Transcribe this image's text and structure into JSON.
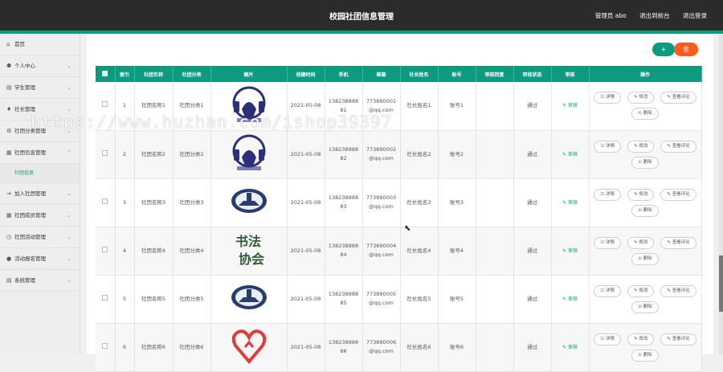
{
  "header": {
    "title": "校园社团信息管理",
    "user_label": "管理员 abo",
    "back_label": "退出到前台",
    "logout_label": "退出登录"
  },
  "sidebar": {
    "items": [
      {
        "label": "首页",
        "icon": "home-icon",
        "glyph": "⌂"
      },
      {
        "label": "个人中心",
        "icon": "user-icon",
        "glyph": "⚉"
      },
      {
        "label": "学生管理",
        "icon": "folder-icon",
        "glyph": "▤"
      },
      {
        "label": "社长管理",
        "icon": "mic-icon",
        "glyph": "♦"
      },
      {
        "label": "社团分类管理",
        "icon": "gear-icon",
        "glyph": "⚙"
      },
      {
        "label": "社团信息管理",
        "icon": "grid-icon",
        "glyph": "▦"
      },
      {
        "label": "加入社团管理",
        "icon": "login-icon",
        "glyph": "⇥"
      },
      {
        "label": "社团成员管理",
        "icon": "grid-icon",
        "glyph": "▦"
      },
      {
        "label": "社团活动管理",
        "icon": "clock-icon",
        "glyph": "◷"
      },
      {
        "label": "活动报名管理",
        "icon": "pin-icon",
        "glyph": "●"
      },
      {
        "label": "系统管理",
        "icon": "list-icon",
        "glyph": "▤"
      }
    ],
    "active_sub": "社团信息"
  },
  "toolbar": {
    "add_label": "+",
    "delete_label": "金"
  },
  "table": {
    "headers": [
      "",
      "索引",
      "社团名称",
      "社团分类",
      "图片",
      "创建时间",
      "手机",
      "邮箱",
      "社长姓名",
      "账号",
      "审核回复",
      "审核状态",
      "审核",
      "操作"
    ],
    "rows": [
      {
        "index": "1",
        "name": "社团名称1",
        "category": "社团分类1",
        "date": "2021-05-08",
        "phone_a": "138238888",
        "phone_b": "81",
        "email_a": "773890001",
        "email_b": "@qq.com",
        "leader": "社长姓名1",
        "account": "账号1",
        "reply": "",
        "status": "通过",
        "logo": "headphone"
      },
      {
        "index": "2",
        "name": "社团名称2",
        "category": "社团分类2",
        "date": "2021-05-08",
        "phone_a": "138238888",
        "phone_b": "82",
        "email_a": "773890002",
        "email_b": "@qq.com",
        "leader": "社长姓名2",
        "account": "账号2",
        "reply": "",
        "status": "通过",
        "logo": "headphone"
      },
      {
        "index": "3",
        "name": "社团名称3",
        "category": "社团分类3",
        "date": "2021-05-08",
        "phone_a": "138238888",
        "phone_b": "83",
        "email_a": "773890003",
        "email_b": "@qq.com",
        "leader": "社长姓名3",
        "account": "账号3",
        "reply": "",
        "status": "通过",
        "logo": "seal"
      },
      {
        "index": "4",
        "name": "社团名称4",
        "category": "社团分类4",
        "date": "2021-05-08",
        "phone_a": "138238888",
        "phone_b": "84",
        "email_a": "773890004",
        "email_b": "@qq.com",
        "leader": "社长姓名4",
        "account": "账号4",
        "reply": "",
        "status": "通过",
        "logo": "calligraphy"
      },
      {
        "index": "5",
        "name": "社团名称5",
        "category": "社团分类5",
        "date": "2021-05-08",
        "phone_a": "138238888",
        "phone_b": "85",
        "email_a": "773890005",
        "email_b": "@qq.com",
        "leader": "社长姓名5",
        "account": "账号5",
        "reply": "",
        "status": "通过",
        "logo": "seal"
      },
      {
        "index": "6",
        "name": "社团名称6",
        "category": "社团分类6",
        "date": "2021-05-08",
        "phone_a": "138238888",
        "phone_b": "86",
        "email_a": "773890006",
        "email_b": "@qq.com",
        "leader": "社长姓名6",
        "account": "账号6",
        "reply": "",
        "status": "通过",
        "logo": "heart"
      }
    ],
    "audit_label": "✎ 审核",
    "op_labels": {
      "detail": "☷ 详情",
      "edit": "✎ 修改",
      "review": "✎ 查看评论",
      "delete": "⊙ 删除"
    }
  },
  "logo_text": {
    "calligraphy_1": "书法",
    "calligraphy_2": "协会"
  },
  "watermark": "https://www.huzhan.com/ishop39397",
  "colors": {
    "accent": "#0e9a7e",
    "danger": "#ff5a1e",
    "header": "#2b2b2b"
  }
}
